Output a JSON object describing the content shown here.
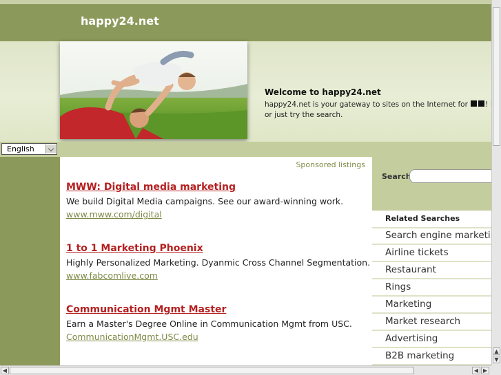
{
  "header": {
    "site_title": "happy24.net"
  },
  "hero": {
    "welcome_title": "Welcome to happy24.net",
    "welcome_line1_start": "happy24.net is your gateway to sites on the Internet for",
    "welcome_line1_end": "! Browse",
    "welcome_line2": "or just try the search."
  },
  "language": {
    "selected": "English"
  },
  "main": {
    "sponsored_label": "Sponsored listings",
    "ads": [
      {
        "title": "MWW: Digital media marketing",
        "description": "We build Digital Media campaigns. See our award-winning work.",
        "url": "www.mww.com/digital"
      },
      {
        "title": "1 to 1 Marketing Phoenix",
        "description": "Highly Personalized Marketing. Dyanmic Cross Channel Segmentation.",
        "url": "www.fabcomlive.com"
      },
      {
        "title": "Communication Mgmt Master",
        "description": "Earn a Master's Degree Online in Communication Mgmt from USC.",
        "url": "CommunicationMgmt.USC.edu"
      }
    ]
  },
  "sidebar": {
    "search_label": "Search",
    "related_header": "Related Searches",
    "related": [
      "Search engine marketing",
      "Airline tickets",
      "Restaurant",
      "Rings",
      "Marketing",
      "Market research",
      "Advertising",
      "B2B marketing"
    ]
  },
  "icons": {
    "flag": "flag-squares-icon",
    "dropdown": "chevron-down-icon"
  }
}
